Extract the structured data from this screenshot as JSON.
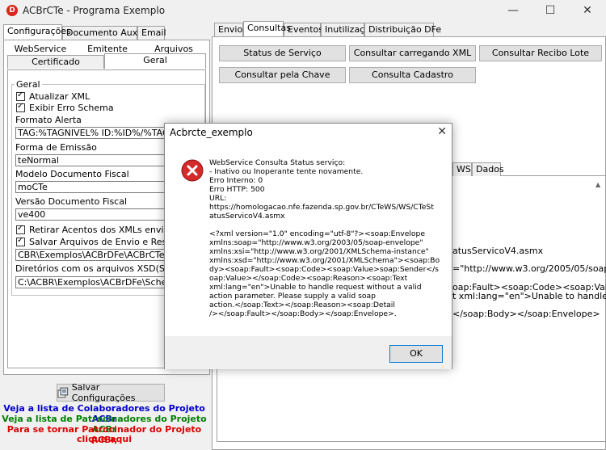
{
  "window": {
    "title": "ACBrCTe - Programa Exemplo",
    "controls": {
      "minimize": "—",
      "maximize": "☐",
      "close": "✕"
    }
  },
  "left_panel": {
    "tabs": [
      "Configurações",
      "Documento Auxiliar",
      "Email"
    ],
    "subtabs_row1": [
      "WebService",
      "Emitente",
      "Arquivos"
    ],
    "subtabs_row2": [
      "Certificado",
      "Geral"
    ],
    "group_label": "Geral",
    "atualizar_xml": "Atualizar XML",
    "exibir_erro_schema": "Exibir Erro Schema",
    "formato_alerta_label": "Formato Alerta",
    "formato_alerta_value": "TAG:%TAGNIVEL% ID:%ID%/%TAG%(%DESCRICAO%)",
    "forma_emissao_label": "Forma de Emissão",
    "forma_emissao_value": "teNormal",
    "modelo_label": "Modelo Documento Fiscal",
    "modelo_value": "moCTe",
    "versao_label": "Versão Documento Fiscal",
    "versao_value": "ve400",
    "retirar_acentos": "Retirar Acentos dos XMLs enviados",
    "salvar_arquivos": "Salvar Arquivos de Envio e Resposta",
    "caminho_value": "CBR\\Exemplos\\ACBrDFe\\ACBrCTe\\Delphi\\Logs",
    "xsd_label": "Diretórios com os arquivos XSD(Schemas)",
    "xsd_value": "C:\\ACBR\\Exemplos\\ACBrDFe\\Schemas\\CTe",
    "save_button": "Salvar Configurações",
    "link_colaboradores": "Veja a lista de Colaboradores do Projeto ACBr",
    "link_patrocinadores": "Veja a lista de Patrocinadores do Projeto ACBr",
    "link_patrocinador_1": "Para se tornar Patrocinador do Projeto ACBr,",
    "link_patrocinador_2": "clique aqui"
  },
  "right_panel": {
    "tabs": [
      "Envios",
      "Consultas",
      "Eventos",
      "Inutilização",
      "Distribuição DFe"
    ],
    "buttons": {
      "status_servico": "Status de Serviço",
      "consultar_xml": "Consultar carregando XML",
      "consultar_recibo": "Consultar Recibo Lote",
      "consultar_chave": "Consultar pela Chave",
      "consulta_cadastro": "Consulta Cadastro"
    },
    "inner_tabs": [
      "WS",
      "Dados"
    ],
    "memo_lines": [
      "atusServicoV4.asmx",
      "=\"http://www.w3.org/2005/05/soap-",
      "oap:Fault><soap:Code><soap:Value>s",
      "t xml:lang=\"en\">Unable to handle",
      "</soap:Body></soap:Envelope>"
    ]
  },
  "dialog": {
    "title": "Acbrcte_exemplo",
    "close": "✕",
    "message_lines": [
      "WebService Consulta Status serviço:",
      "- Inativo ou Inoperante tente novamente.",
      "Erro Interno: 0",
      "Erro HTTP: 500",
      "URL:",
      "https://homologacao.nfe.fazenda.sp.gov.br/CTeWS/WS/CTeSt",
      "atusServicoV4.asmx",
      "",
      "<?xml version=\"1.0\" encoding=\"utf-8\"?><soap:Envelope",
      "xmlns:soap=\"http://www.w3.org/2003/05/soap-envelope\"",
      "xmlns:xsi=\"http://www.w3.org/2001/XMLSchema-instance\"",
      "xmlns:xsd=\"http://www.w3.org/2001/XMLSchema\"><soap:Bo",
      "dy><soap:Fault><soap:Code><soap:Value>soap:Sender</s",
      "oap:Value></soap:Code><soap:Reason><soap:Text",
      "xml:lang=\"en\">Unable to handle request without a valid",
      "action parameter. Please supply a valid soap",
      "action.</soap:Text></soap:Reason><soap:Detail",
      "/></soap:Fault></soap:Body></soap:Envelope>."
    ],
    "ok_button": "OK"
  },
  "colors": {
    "error_red": "#d42a2a",
    "link_blue": "#0000cc",
    "link_green": "#008000",
    "link_red": "#dd0000"
  }
}
